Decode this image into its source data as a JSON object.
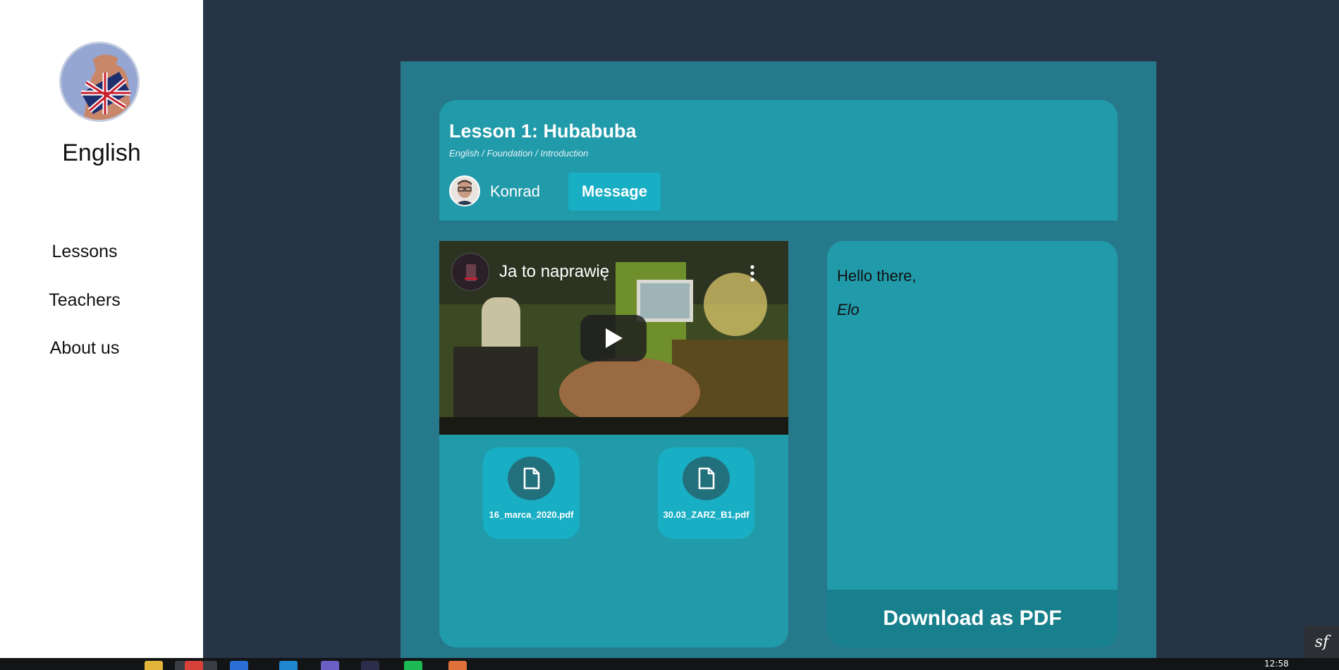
{
  "sidebar": {
    "brand": "English",
    "nav": [
      {
        "label": "Lessons"
      },
      {
        "label": "Teachers"
      },
      {
        "label": "About us"
      }
    ]
  },
  "lesson": {
    "title": "Lesson 1: Hubabuba",
    "breadcrumb": "English / Foundation / Introduction",
    "teacher_name": "Konrad",
    "message_label": "Message"
  },
  "video": {
    "title": "Ja to naprawię",
    "icons": {
      "play": "play-icon",
      "menu": "more-vertical-icon"
    }
  },
  "files": [
    {
      "name": "16_marca_2020.pdf",
      "icon": "file-icon"
    },
    {
      "name": "30.03_ZARZ_B1.pdf",
      "icon": "file-icon"
    }
  ],
  "notes": {
    "line1": "Hello there,",
    "line2": "Elo",
    "download_label": "Download as PDF"
  },
  "taskbar": {
    "clock": "12:58"
  },
  "colors": {
    "background": "#273446",
    "panel": "#26798a",
    "card": "#219aaa",
    "accent": "#18aec3",
    "pdf_button": "#187f8d"
  }
}
